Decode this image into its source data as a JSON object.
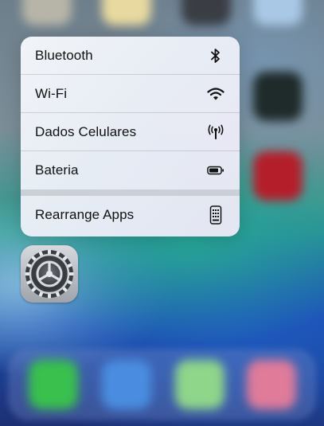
{
  "quick_actions": {
    "items": [
      {
        "label": "Bluetooth",
        "icon": "bluetooth-icon"
      },
      {
        "label": "Wi-Fi",
        "icon": "wifi-icon"
      },
      {
        "label": "Dados Celulares",
        "icon": "cellular-antenna-icon"
      },
      {
        "label": "Bateria",
        "icon": "battery-icon"
      }
    ],
    "system_item": {
      "label": "Rearrange Apps",
      "icon": "rearrange-apps-icon"
    }
  },
  "app": {
    "icon": "settings-gear-icon"
  }
}
